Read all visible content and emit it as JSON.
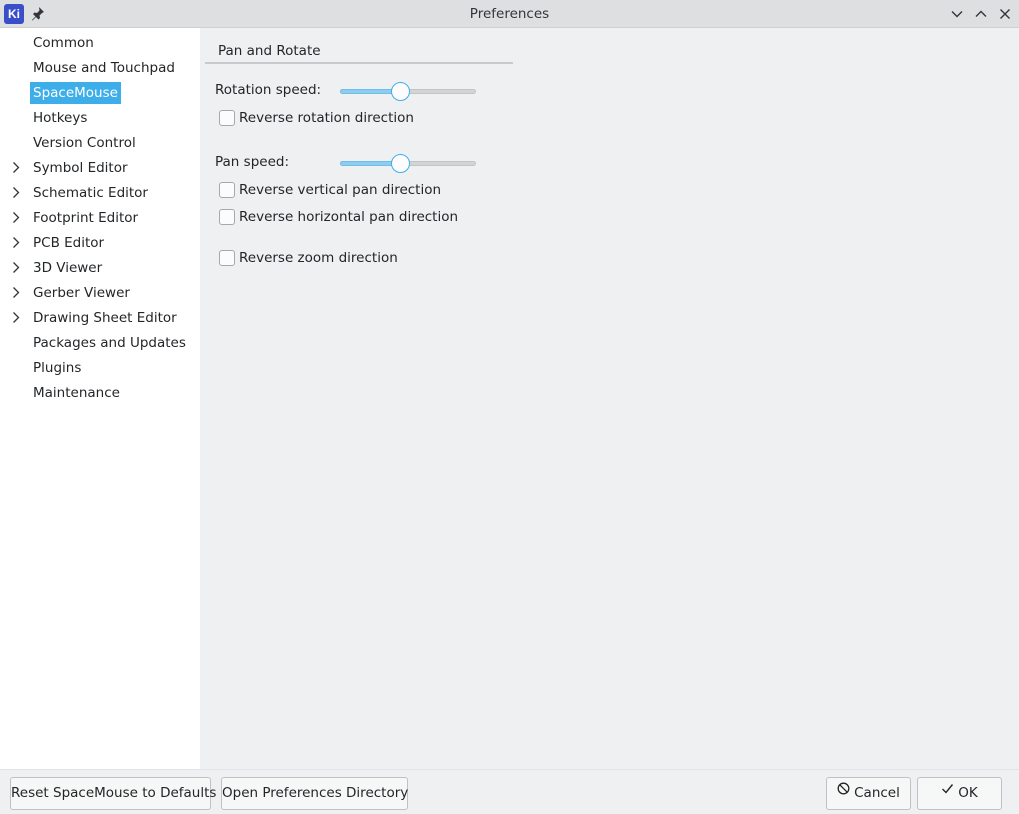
{
  "window": {
    "title": "Preferences",
    "app_icon_text": "Ki"
  },
  "sidebar": {
    "items": [
      {
        "label": "Common",
        "expandable": false,
        "selected": false
      },
      {
        "label": "Mouse and Touchpad",
        "expandable": false,
        "selected": false
      },
      {
        "label": "SpaceMouse",
        "expandable": false,
        "selected": true
      },
      {
        "label": "Hotkeys",
        "expandable": false,
        "selected": false
      },
      {
        "label": "Version Control",
        "expandable": false,
        "selected": false
      },
      {
        "label": "Symbol Editor",
        "expandable": true,
        "selected": false
      },
      {
        "label": "Schematic Editor",
        "expandable": true,
        "selected": false
      },
      {
        "label": "Footprint Editor",
        "expandable": true,
        "selected": false
      },
      {
        "label": "PCB Editor",
        "expandable": true,
        "selected": false
      },
      {
        "label": "3D Viewer",
        "expandable": true,
        "selected": false
      },
      {
        "label": "Gerber Viewer",
        "expandable": true,
        "selected": false
      },
      {
        "label": "Drawing Sheet Editor",
        "expandable": true,
        "selected": false
      },
      {
        "label": "Packages and Updates",
        "expandable": false,
        "selected": false
      },
      {
        "label": "Plugins",
        "expandable": false,
        "selected": false
      },
      {
        "label": "Maintenance",
        "expandable": false,
        "selected": false
      }
    ]
  },
  "panel": {
    "section_title": "Pan and Rotate",
    "rotation_speed_label": "Rotation speed:",
    "rotation_speed_fraction": 0.44,
    "reverse_rotation_label": "Reverse rotation direction",
    "reverse_rotation_checked": false,
    "pan_speed_label": "Pan speed:",
    "pan_speed_fraction": 0.44,
    "reverse_vertical_pan_label": "Reverse vertical pan direction",
    "reverse_vertical_pan_checked": false,
    "reverse_horizontal_pan_label": "Reverse horizontal pan direction",
    "reverse_horizontal_pan_checked": false,
    "reverse_zoom_label": "Reverse zoom direction",
    "reverse_zoom_checked": false
  },
  "footer": {
    "reset_label": "Reset SpaceMouse to Defaults",
    "open_dir_label": "Open Preferences Directory",
    "cancel_label": "Cancel",
    "ok_label": "OK"
  },
  "colors": {
    "accent": "#3daee9",
    "app_icon": "#3b4ec9"
  },
  "icons": {
    "app": "kicad-icon",
    "pin": "pin-icon",
    "minimize": "chevron-down-icon",
    "maximize": "chevron-up-icon",
    "close": "close-icon",
    "expand": "chevron-right-icon",
    "cancel": "cancel-icon",
    "ok": "checkmark-icon"
  }
}
